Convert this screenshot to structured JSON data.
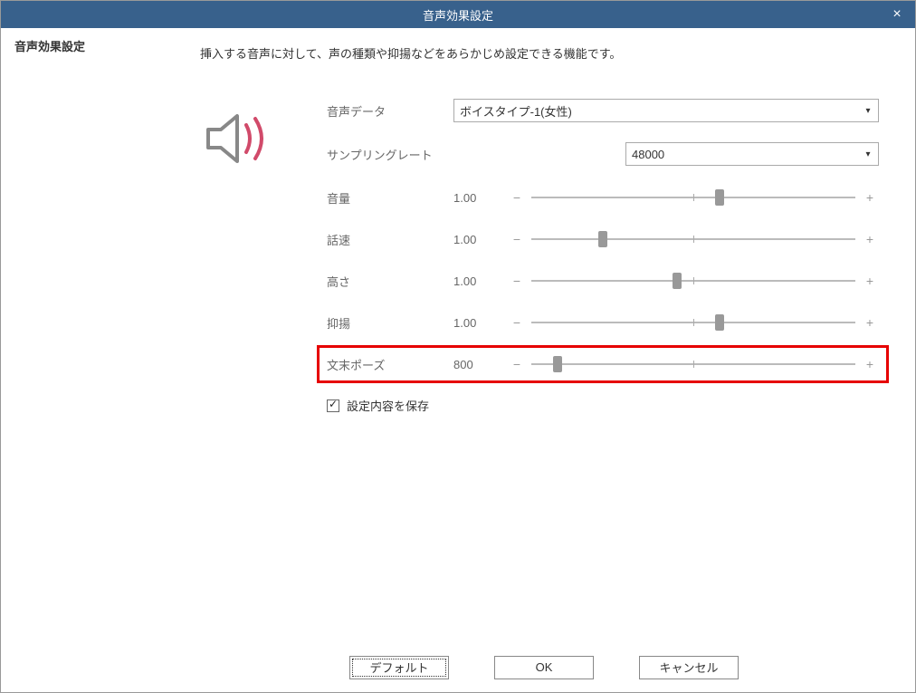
{
  "title": "音声効果設定",
  "close_glyph": "×",
  "sidebar": {
    "tab_label": "音声効果設定"
  },
  "description": "挿入する音声に対して、声の種類や抑揚などをあらかじめ設定できる機能です。",
  "form": {
    "voice_data": {
      "label": "音声データ",
      "value": "ボイスタイプ-1(女性)"
    },
    "sampling_rate": {
      "label": "サンプリングレート",
      "value": "48000"
    },
    "sliders": [
      {
        "key": "volume",
        "label": "音量",
        "value": "1.00",
        "position": 58
      },
      {
        "key": "speed",
        "label": "話速",
        "value": "1.00",
        "position": 22
      },
      {
        "key": "pitch",
        "label": "高さ",
        "value": "1.00",
        "position": 45
      },
      {
        "key": "intonation",
        "label": "抑揚",
        "value": "1.00",
        "position": 58
      },
      {
        "key": "endpause",
        "label": "文末ポーズ",
        "value": "800",
        "position": 8,
        "highlighted": true
      }
    ],
    "save_checkbox": {
      "label": "設定内容を保存",
      "checked": true
    }
  },
  "buttons": {
    "default": "デフォルト",
    "ok": "OK",
    "cancel": "キャンセル"
  },
  "glyphs": {
    "dropdown": "▾",
    "minus": "−",
    "plus": "+"
  }
}
